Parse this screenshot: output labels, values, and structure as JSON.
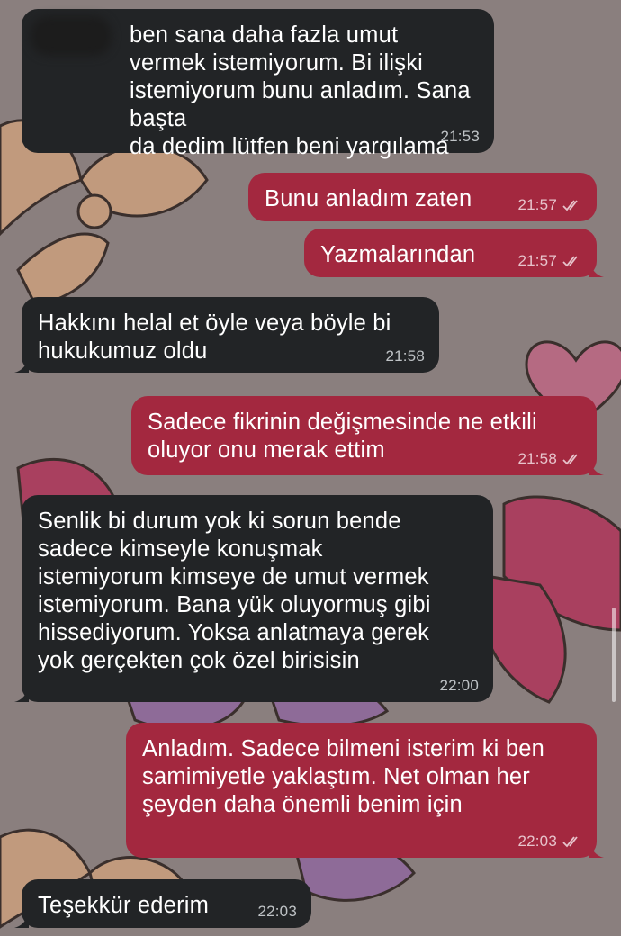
{
  "colors": {
    "incoming_bubble": "#222426",
    "outgoing_bubble": "#a3283f",
    "wallpaper": "#8a7f7e"
  },
  "messages": [
    {
      "direction": "in",
      "text": "ben sana daha fazla umut\nvermek istemiyorum. Bi ilişki\nistemiyorum bunu anladım. Sana başta\nda dedim lütfen beni yargılama",
      "time": "21:53",
      "redacted_prefix": true
    },
    {
      "direction": "out",
      "text": "Bunu anladım zaten",
      "time": "21:57",
      "status": "read"
    },
    {
      "direction": "out",
      "text": "Yazmalarından",
      "time": "21:57",
      "status": "read"
    },
    {
      "direction": "in",
      "text": "Hakkını helal et öyle veya böyle bi\nhukukumuz oldu",
      "time": "21:58"
    },
    {
      "direction": "out",
      "text": "Sadece fikrinin değişmesinde ne etkili\noluyor onu merak ettim",
      "time": "21:58",
      "status": "read"
    },
    {
      "direction": "in",
      "text": "Senlik bi durum yok ki sorun bende\nsadece kimseyle konuşmak\nistemiyorum kimseye de umut vermek\nistemiyorum. Bana yük oluyormuş gibi\nhissediyorum. Yoksa anlatmaya gerek\nyok gerçekten çok özel birisisin",
      "time": "22:00"
    },
    {
      "direction": "out",
      "text": "Anladım. Sadece bilmeni isterim ki ben\nsamimiyetle yaklaştım. Net olman her\nşeyden daha önemli benim için",
      "time": "22:03",
      "status": "read"
    },
    {
      "direction": "in",
      "text": "Teşekkür ederim",
      "time": "22:03"
    }
  ]
}
